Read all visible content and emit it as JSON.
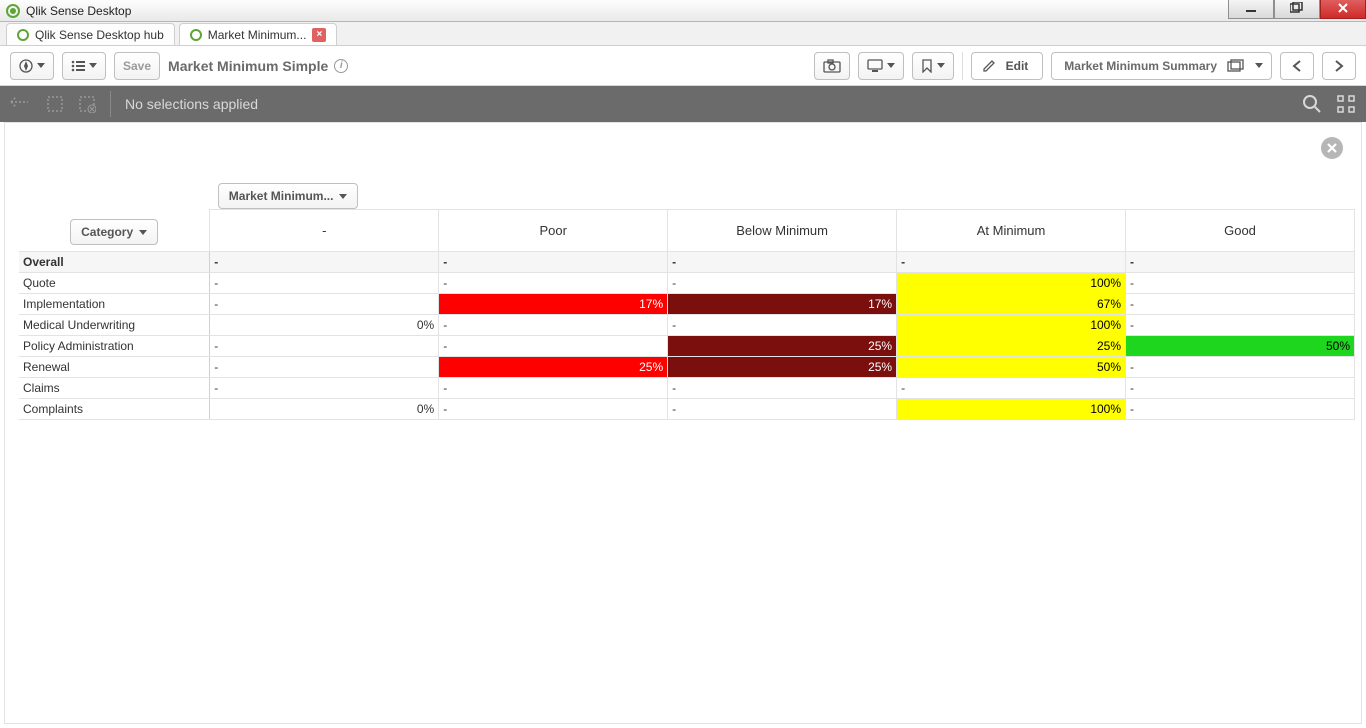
{
  "window": {
    "title": "Qlik Sense Desktop"
  },
  "tabs": [
    {
      "label": "Qlik Sense Desktop hub",
      "closable": false
    },
    {
      "label": "Market Minimum...",
      "closable": true,
      "active": true
    }
  ],
  "toolbar": {
    "save_label": "Save",
    "sheet_title": "Market Minimum Simple",
    "edit_label": "Edit",
    "summary_label": "Market Minimum Summary"
  },
  "selection_bar": {
    "text": "No selections applied"
  },
  "pivot": {
    "column_dim_button": "Market Minimum...",
    "row_dim_button": "Category",
    "columns": [
      "-",
      "Poor",
      "Below Minimum",
      "At Minimum",
      "Good"
    ],
    "rows": [
      {
        "label": "Overall",
        "overall": true,
        "cells": [
          {
            "v": "-"
          },
          {
            "v": "-"
          },
          {
            "v": "-"
          },
          {
            "v": "-"
          },
          {
            "v": "-"
          }
        ]
      },
      {
        "label": "Quote",
        "cells": [
          {
            "v": "-"
          },
          {
            "v": "-"
          },
          {
            "v": "-"
          },
          {
            "v": "100%",
            "bg": "yellow"
          },
          {
            "v": "-"
          }
        ]
      },
      {
        "label": "Implementation",
        "cells": [
          {
            "v": "-"
          },
          {
            "v": "17%",
            "bg": "red"
          },
          {
            "v": "17%",
            "bg": "darkred"
          },
          {
            "v": "67%",
            "bg": "yellow"
          },
          {
            "v": "-"
          }
        ]
      },
      {
        "label": "Medical Underwriting",
        "cells": [
          {
            "v": "0%"
          },
          {
            "v": "-"
          },
          {
            "v": "-"
          },
          {
            "v": "100%",
            "bg": "yellow"
          },
          {
            "v": "-"
          }
        ]
      },
      {
        "label": "Policy Administration",
        "cells": [
          {
            "v": "-"
          },
          {
            "v": "-"
          },
          {
            "v": "25%",
            "bg": "darkred"
          },
          {
            "v": "25%",
            "bg": "yellow"
          },
          {
            "v": "50%",
            "bg": "green"
          }
        ]
      },
      {
        "label": "Renewal",
        "cells": [
          {
            "v": "-"
          },
          {
            "v": "25%",
            "bg": "red"
          },
          {
            "v": "25%",
            "bg": "darkred"
          },
          {
            "v": "50%",
            "bg": "yellow"
          },
          {
            "v": "-"
          }
        ]
      },
      {
        "label": "Claims",
        "cells": [
          {
            "v": "-"
          },
          {
            "v": "-"
          },
          {
            "v": "-"
          },
          {
            "v": "-"
          },
          {
            "v": "-"
          }
        ]
      },
      {
        "label": "Complaints",
        "cells": [
          {
            "v": "0%"
          },
          {
            "v": "-"
          },
          {
            "v": "-"
          },
          {
            "v": "100%",
            "bg": "yellow"
          },
          {
            "v": "-"
          }
        ]
      }
    ]
  }
}
